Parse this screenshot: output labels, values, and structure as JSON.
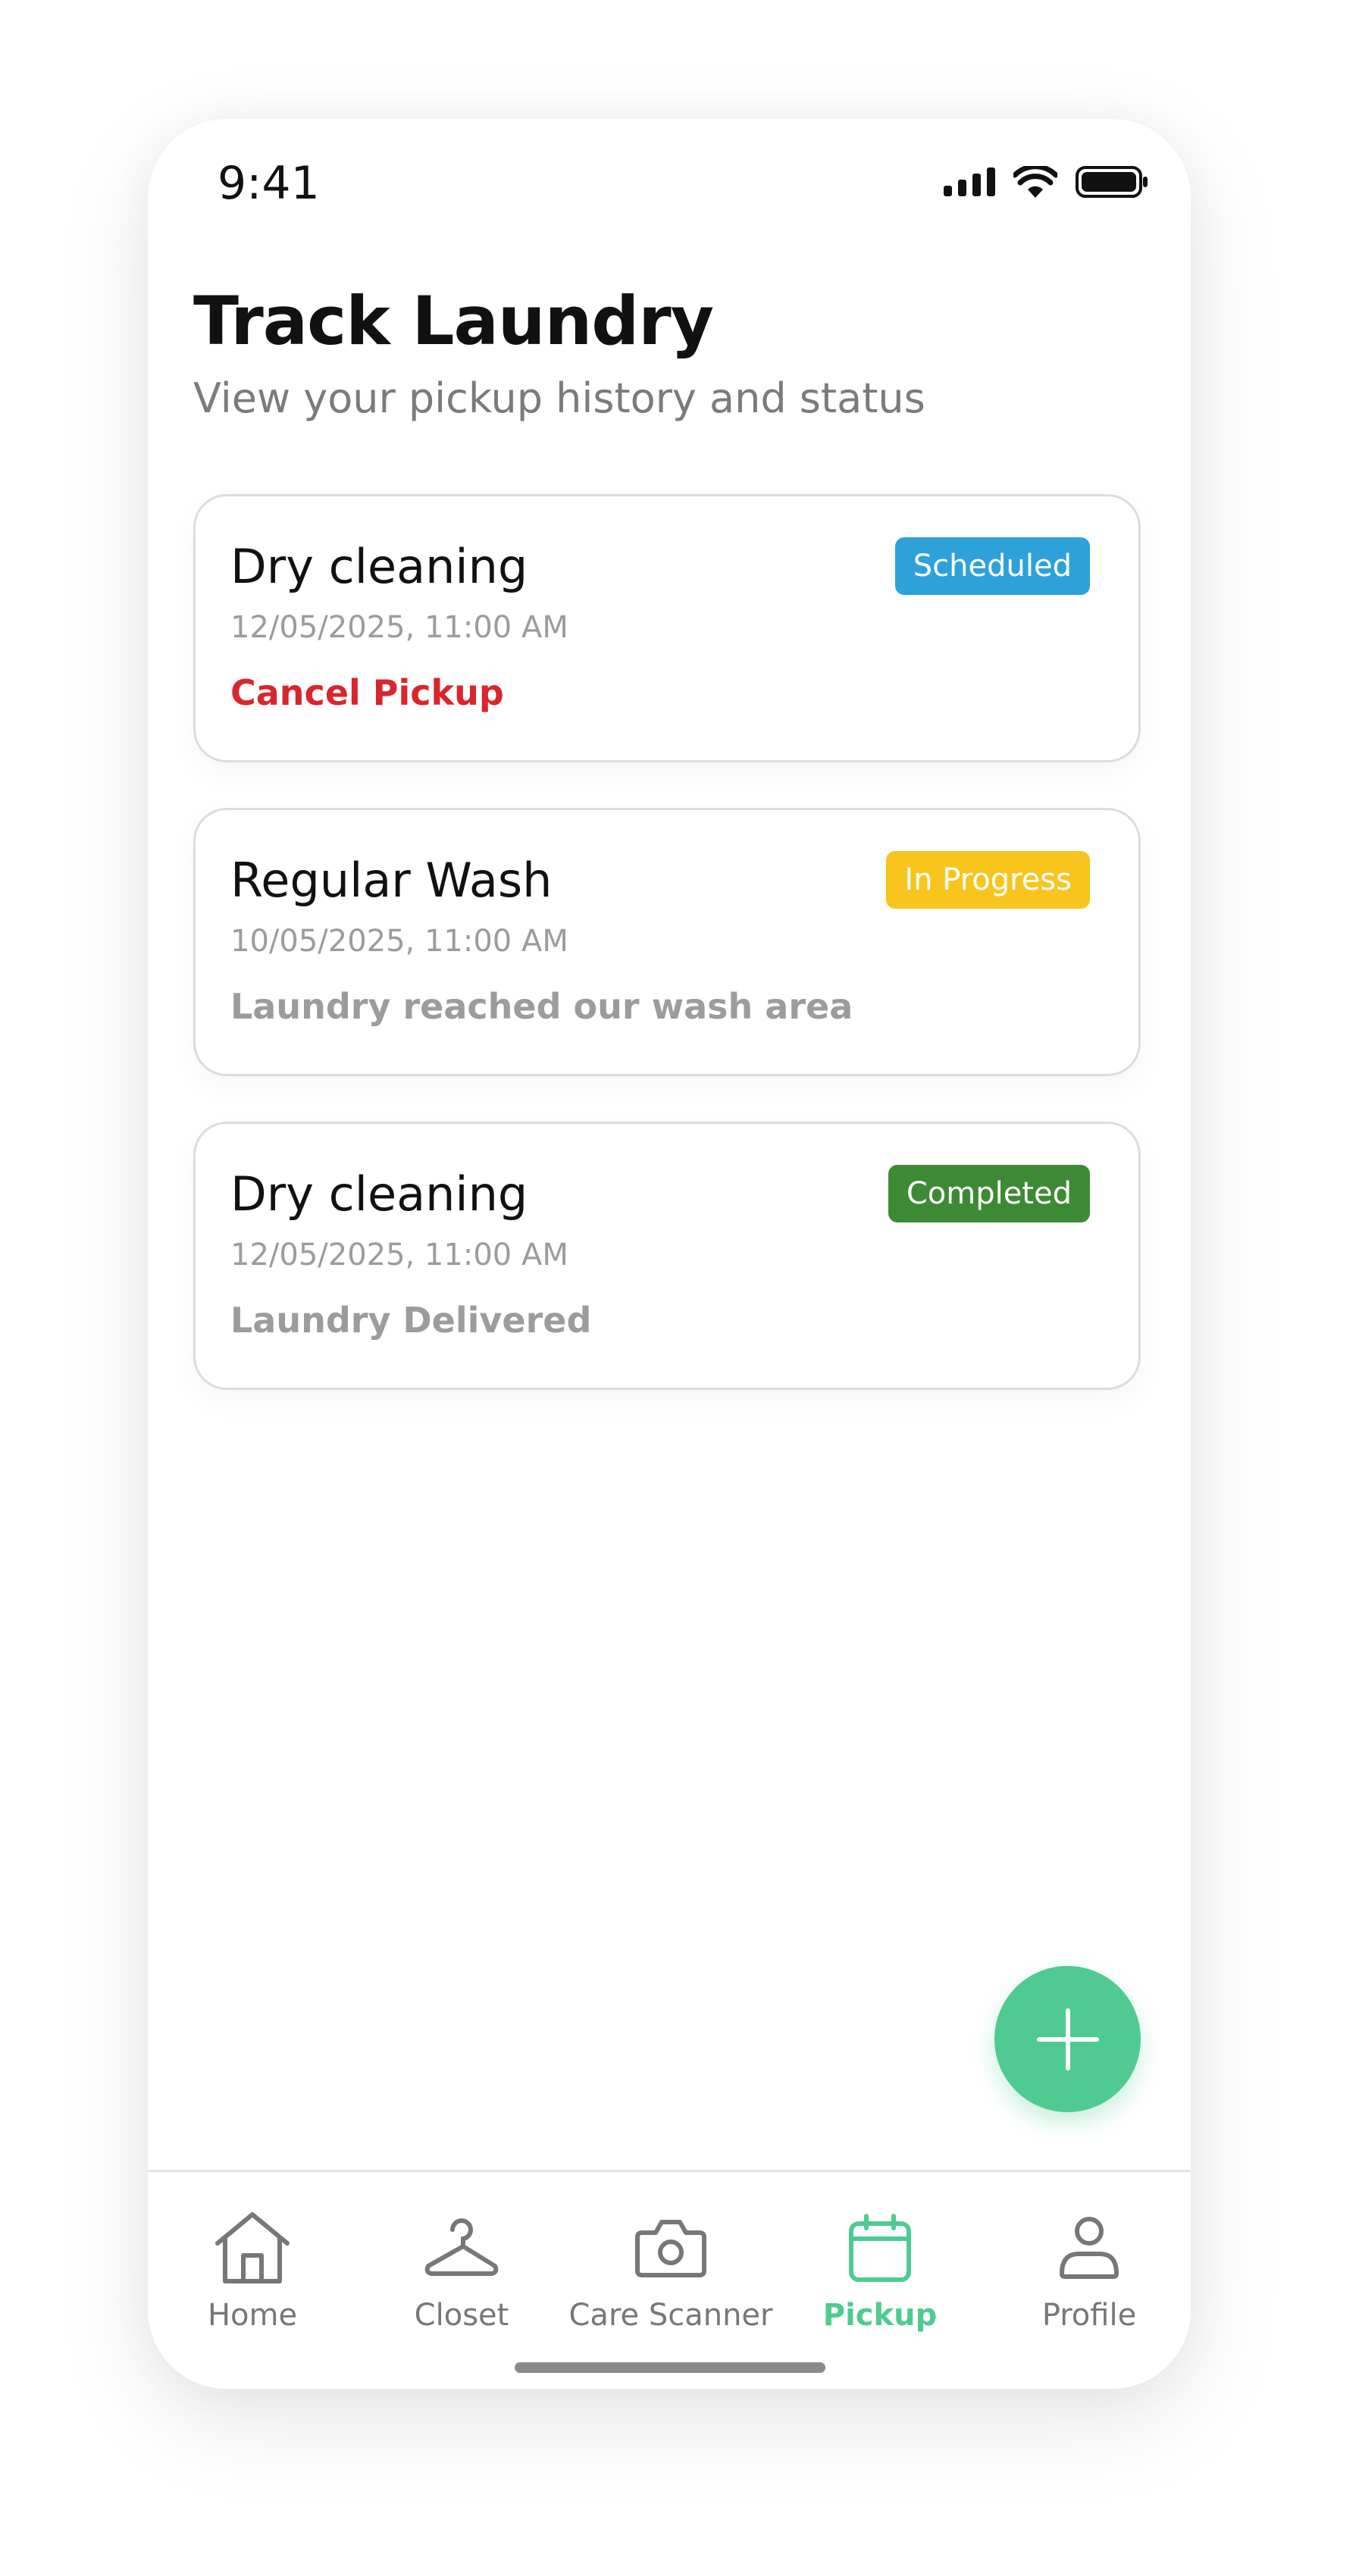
{
  "status_bar": {
    "time": "9:41"
  },
  "header": {
    "title": "Track Laundry",
    "subtitle": "View your pickup history and status"
  },
  "pickups": [
    {
      "service": "Dry cleaning",
      "datetime": "12/05/2025, 11:00 AM",
      "status": "Scheduled",
      "status_color": "#2ea1d9",
      "detail": "Cancel Pickup"
    },
    {
      "service": "Regular Wash",
      "datetime": "10/05/2025, 11:00 AM",
      "status": "In Progress",
      "status_color": "#f7c51d",
      "detail": "Laundry reached our wash area"
    },
    {
      "service": "Dry cleaning",
      "datetime": "12/05/2025, 11:00 AM",
      "status": "Completed",
      "status_color": "#3d8a35",
      "detail": "Laundry Delivered"
    }
  ],
  "fab": {
    "icon": "plus-icon",
    "color": "#4fcb91"
  },
  "bottom_nav": {
    "active_color": "#4fcb91",
    "items": [
      {
        "label": "Home",
        "icon": "home-icon"
      },
      {
        "label": "Closet",
        "icon": "hanger-icon"
      },
      {
        "label": "Care Scanner",
        "icon": "camera-icon"
      },
      {
        "label": "Pickup",
        "icon": "calendar-icon",
        "active": true
      },
      {
        "label": "Profile",
        "icon": "user-icon"
      }
    ]
  }
}
